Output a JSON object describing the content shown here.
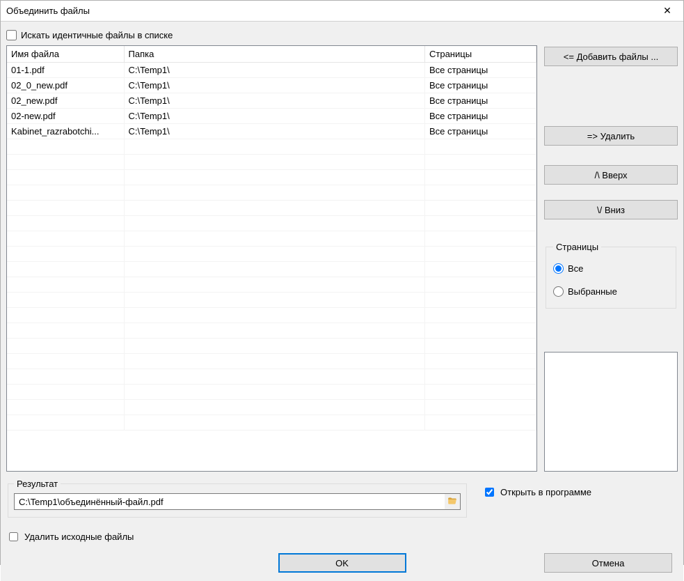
{
  "window": {
    "title": "Объединить файлы"
  },
  "checkboxes": {
    "search_identical": "Искать идентичные файлы в списке",
    "open_in_program": "Открыть в программе",
    "delete_source": "Удалить исходные файлы"
  },
  "table": {
    "headers": {
      "filename": "Имя файла",
      "folder": "Папка",
      "pages": "Страницы"
    },
    "rows": [
      {
        "filename": "01-1.pdf",
        "folder": "C:\\Temp1\\",
        "pages": "Все страницы"
      },
      {
        "filename": "02_0_new.pdf",
        "folder": "C:\\Temp1\\",
        "pages": "Все страницы"
      },
      {
        "filename": "02_new.pdf",
        "folder": "C:\\Temp1\\",
        "pages": "Все страницы"
      },
      {
        "filename": "02-new.pdf",
        "folder": "C:\\Temp1\\",
        "pages": "Все страницы"
      },
      {
        "filename": "Kabinet_razrabotchi...",
        "folder": "C:\\Temp1\\",
        "pages": "Все страницы"
      }
    ]
  },
  "buttons": {
    "add_files": "<= Добавить файлы ...",
    "remove": "=> Удалить",
    "up": "/\\  Вверх",
    "down": "\\/  Вниз",
    "ok": "OK",
    "cancel": "Отмена"
  },
  "pages_group": {
    "legend": "Страницы",
    "all": "Все",
    "selected": "Выбранные"
  },
  "result": {
    "legend": "Результат",
    "path": "C:\\Temp1\\объединённый-файл.pdf"
  }
}
